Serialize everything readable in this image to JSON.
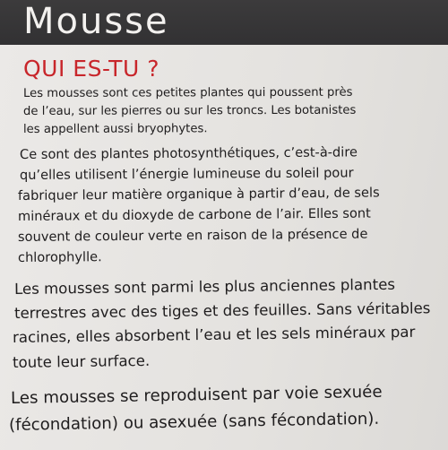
{
  "sign": {
    "title": "Mousse",
    "subtitle": "QUI ES-TU ?",
    "paragraphs": [
      {
        "lines": [
          "Les mousses sont ces petites plantes qui poussent près",
          "de l’eau, sur les pierres ou sur les troncs. Les botanistes",
          "les appellent aussi bryophytes."
        ]
      },
      {
        "lines": [
          "Ce sont des plantes photosynthétiques, c’est-à-dire",
          "qu’elles utilisent l’énergie lumineuse du soleil pour",
          "fabriquer leur matière organique à partir d’eau, de sels",
          "minéraux et du dioxyde de carbone de l’air. Elles sont",
          "souvent de couleur verte en raison de la présence de",
          "chlorophylle."
        ]
      },
      {
        "lines": [
          "Les mousses sont parmi les plus anciennes plantes",
          "terrestres avec des tiges et des feuilles. Sans véritables",
          "racines, elles absorbent l’eau et les sels minéraux par",
          "toute leur surface."
        ]
      },
      {
        "lines": [
          "Les mousses se reproduisent par voie sexuée",
          "(fécondation) ou asexuée (sans fécondation)."
        ]
      }
    ]
  }
}
